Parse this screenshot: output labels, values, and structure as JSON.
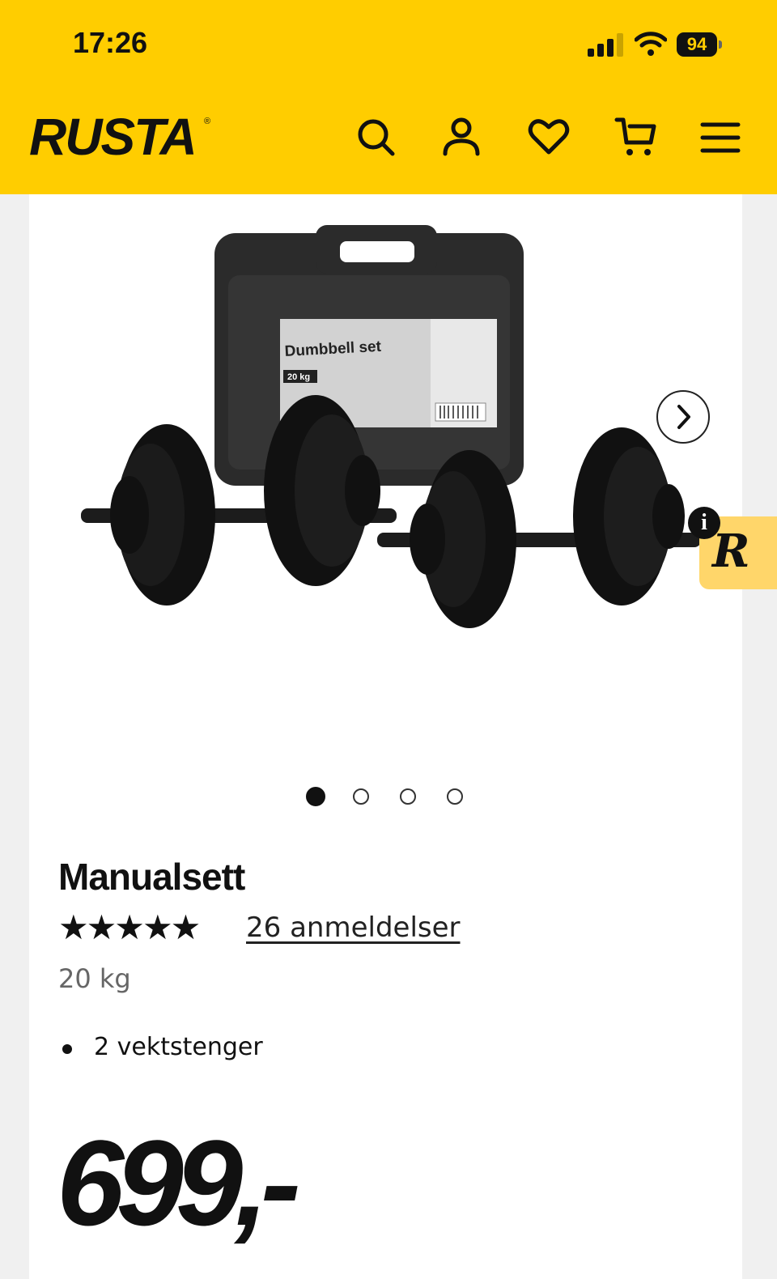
{
  "status_bar": {
    "time": "17:26",
    "battery": "94"
  },
  "header": {
    "logo": "RUSTA",
    "logo_mark": "®",
    "icons": [
      "search-icon",
      "account-icon",
      "heart-icon",
      "cart-icon",
      "menu-icon"
    ],
    "background_color": "#ffcd00"
  },
  "gallery": {
    "box_label": "Dumbbell set",
    "box_weight": "20 kg",
    "slide_count": 4,
    "active_slide": 1
  },
  "reviews_widget": {
    "info": "i",
    "letter": "R",
    "color": "#ffd66a"
  },
  "product": {
    "title": "Manualsett",
    "stars": "★★★★★",
    "rating": 5,
    "reviews_label": "26 anmeldelser",
    "weight": "20 kg",
    "features": [
      "2 vektstenger"
    ],
    "price": "699,-"
  }
}
